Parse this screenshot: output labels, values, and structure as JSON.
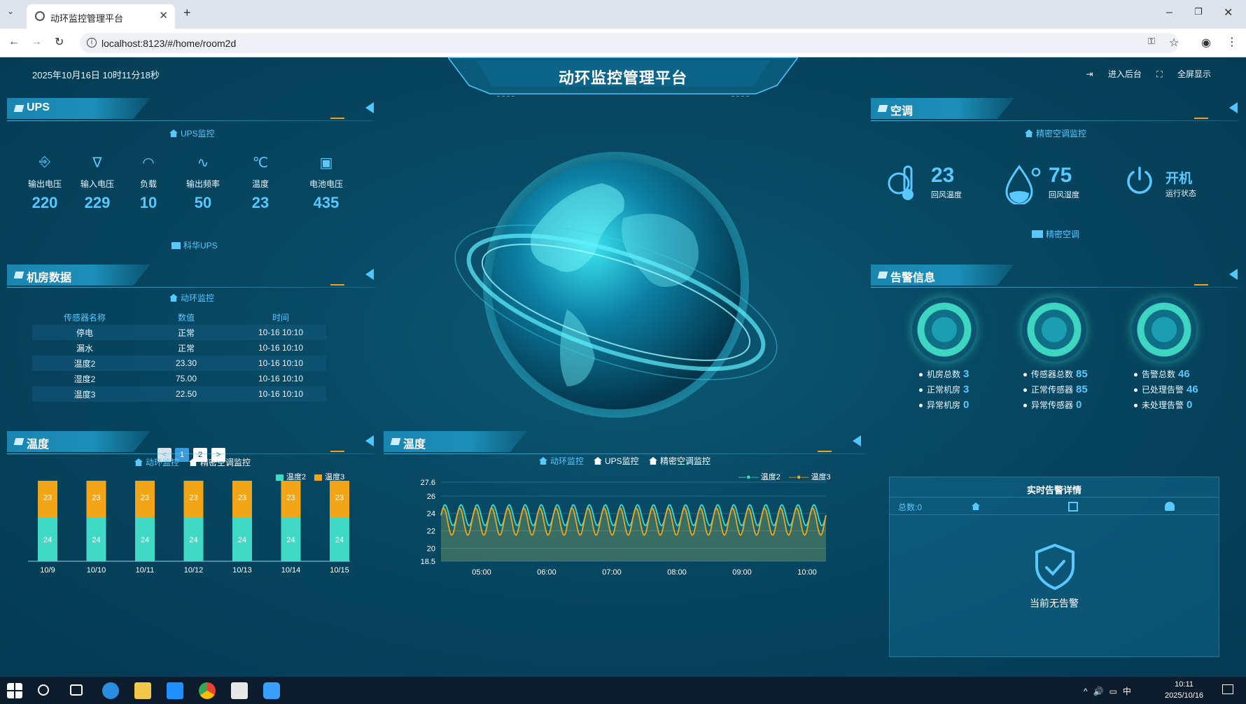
{
  "browser": {
    "tab_title": "动环监控管理平台",
    "url": "localhost:8123/#/home/room2d"
  },
  "header": {
    "datetime": "2025年10月16日 10时11分18秒",
    "title": "动环监控管理平台",
    "enter_backend": "进入后台",
    "fullscreen": "全屏显示"
  },
  "ups": {
    "section_title": "UPS",
    "sub_link": "UPS监控",
    "footer_link": "科华UPS",
    "items": [
      {
        "label": "输出电压",
        "value": "220",
        "icon": "output-voltage-icon"
      },
      {
        "label": "输入电压",
        "value": "229",
        "icon": "input-voltage-icon"
      },
      {
        "label": "负载",
        "value": "10",
        "icon": "load-gauge-icon"
      },
      {
        "label": "输出频率",
        "value": "50",
        "icon": "frequency-icon"
      },
      {
        "label": "温度",
        "value": "23",
        "icon": "celsius-icon"
      },
      {
        "label": "电池电压",
        "value": "435",
        "icon": "battery-icon"
      }
    ]
  },
  "room": {
    "section_title": "机房数据",
    "sub_link": "动环监控",
    "columns": [
      "传感器名称",
      "数值",
      "时间"
    ],
    "rows": [
      [
        "停电",
        "正常",
        "10-16 10:10"
      ],
      [
        "漏水",
        "正常",
        "10-16 10:10"
      ],
      [
        "温度2",
        "23.30",
        "10-16 10:10"
      ],
      [
        "湿度2",
        "75.00",
        "10-16 10:10"
      ],
      [
        "温度3",
        "22.50",
        "10-16 10:10"
      ]
    ],
    "pages": [
      "1",
      "2"
    ],
    "prev": "<",
    "next": ">"
  },
  "temp_left": {
    "section_title": "温度",
    "tab1": "动环监控",
    "tab2": "精密空调监控"
  },
  "temp_mid": {
    "section_title": "温度",
    "tab1": "动环监控",
    "tab2": "UPS监控",
    "tab3": "精密空调监控"
  },
  "aircon": {
    "section_title": "空调",
    "sub_link": "精密空调监控",
    "footer_link": "精密空调",
    "return_temp": "23",
    "return_temp_label": "回风温度",
    "return_humidity": "75",
    "return_humidity_label": "回风湿度",
    "status": "开机",
    "status_label": "运行状态"
  },
  "alarm": {
    "section_title": "告警信息",
    "group1": [
      {
        "label": "机房总数",
        "value": "3"
      },
      {
        "label": "正常机房",
        "value": "3"
      },
      {
        "label": "异常机房",
        "value": "0"
      }
    ],
    "group2": [
      {
        "label": "传感器总数",
        "value": "85"
      },
      {
        "label": "正常传感器",
        "value": "85"
      },
      {
        "label": "异常传感器",
        "value": "0"
      }
    ],
    "group3": [
      {
        "label": "告警总数",
        "value": "46"
      },
      {
        "label": "已处理告警",
        "value": "46"
      },
      {
        "label": "未处理告警",
        "value": "0"
      }
    ]
  },
  "realtime": {
    "title": "实时告警详情",
    "total": "总数:0",
    "message": "当前无告警"
  },
  "taskbar": {
    "time": "10:11",
    "date": "2025/10/16",
    "ime": "中"
  },
  "chart_data": [
    {
      "type": "bar",
      "stacked": true,
      "categories": [
        "10/9",
        "10/10",
        "10/11",
        "10/12",
        "10/13",
        "10/14",
        "10/15"
      ],
      "series": [
        {
          "name": "温度2",
          "values": [
            24,
            24,
            24,
            24,
            24,
            24,
            24
          ],
          "color": "#3fd9c5"
        },
        {
          "name": "温度3",
          "values": [
            23,
            23,
            23,
            23,
            23,
            23,
            23
          ],
          "color": "#f2a516"
        }
      ]
    },
    {
      "type": "line",
      "x_ticks": [
        "05:00",
        "06:00",
        "07:00",
        "08:00",
        "09:00",
        "10:00"
      ],
      "y_ticks": [
        "27.6",
        "26",
        "24",
        "22",
        "20",
        "18.5"
      ],
      "ylim": [
        18.5,
        27.6
      ],
      "series": [
        {
          "name": "温度2",
          "color": "#3fd9c5",
          "min": 22.6,
          "max": 25.0,
          "cycles": 24
        },
        {
          "name": "温度3",
          "color": "#f2a516",
          "min": 21.5,
          "max": 24.6,
          "cycles": 24
        }
      ]
    }
  ]
}
